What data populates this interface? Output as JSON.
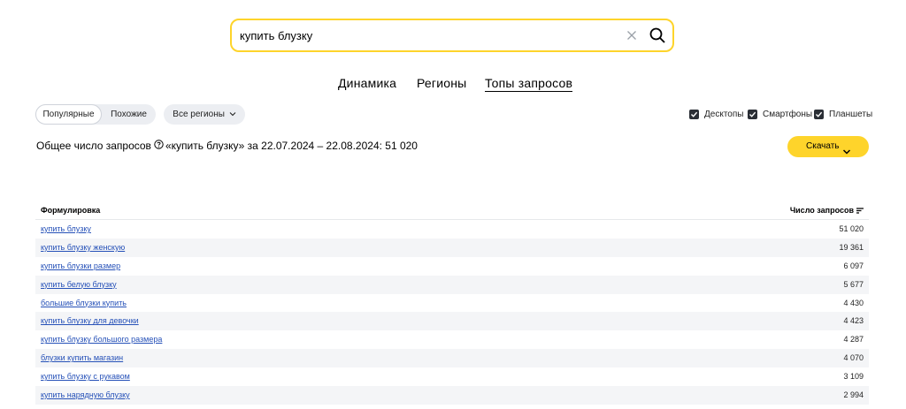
{
  "search": {
    "value": "купить блузку"
  },
  "tabs": [
    {
      "label": "Динамика",
      "active": false
    },
    {
      "label": "Регионы",
      "active": false
    },
    {
      "label": "Топы запросов",
      "active": true
    }
  ],
  "segment": {
    "popular": "Популярные",
    "similar": "Похожие",
    "selected": "Популярные"
  },
  "regions_button": "Все регионы",
  "devices": [
    {
      "label": "Десктопы",
      "checked": true
    },
    {
      "label": "Смартфоны",
      "checked": true
    },
    {
      "label": "Планшеты",
      "checked": true
    }
  ],
  "summary": {
    "prefix": "Общее число запросов",
    "suffix": "«купить блузку» за 22.07.2024 – 22.08.2024: 51 020"
  },
  "download_button": "Скачать",
  "table": {
    "col_query": "Формулировка",
    "col_count": "Число запросов",
    "rows": [
      {
        "query": "купить блузку",
        "count": "51 020"
      },
      {
        "query": "купить блузку женскую",
        "count": "19 361"
      },
      {
        "query": "купить блузки размер",
        "count": "6 097"
      },
      {
        "query": "купить белую блузку",
        "count": "5 677"
      },
      {
        "query": "большие блузки купить",
        "count": "4 430"
      },
      {
        "query": "купить блузку для девочки",
        "count": "4 423"
      },
      {
        "query": "купить блузку большого размера",
        "count": "4 287"
      },
      {
        "query": "блузки купить магазин",
        "count": "4 070"
      },
      {
        "query": "купить блузку с рукавом",
        "count": "3 109"
      },
      {
        "query": "купить нарядную блузку",
        "count": "2 994"
      }
    ]
  },
  "colors": {
    "accent": "#fed42b",
    "link": "#2651b8",
    "stripe": "#f4f5f7"
  },
  "icons": [
    "close-icon",
    "search-icon",
    "chevron-down-icon",
    "help-circle-icon",
    "checkbox-icon",
    "sort-icon"
  ]
}
